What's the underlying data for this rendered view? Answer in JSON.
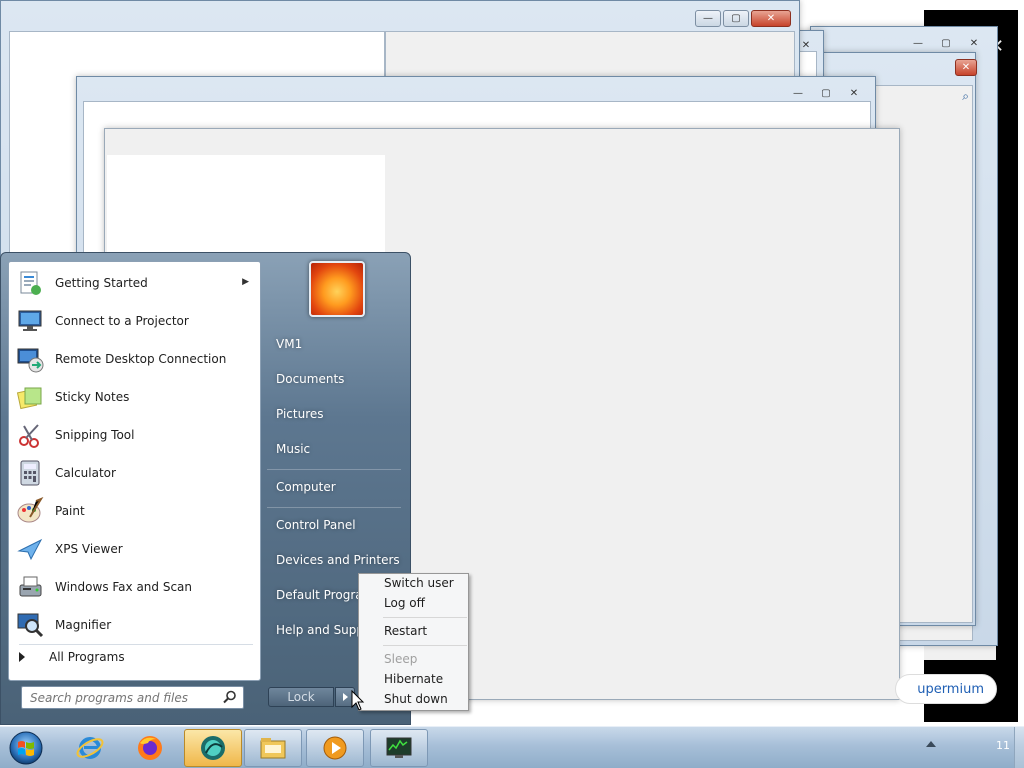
{
  "start_menu": {
    "programs": [
      {
        "label": "Getting Started",
        "icon": "getting-started-icon",
        "has_submenu": true
      },
      {
        "label": "Connect to a Projector",
        "icon": "projector-icon"
      },
      {
        "label": "Remote Desktop Connection",
        "icon": "remote-desktop-icon"
      },
      {
        "label": "Sticky Notes",
        "icon": "sticky-notes-icon"
      },
      {
        "label": "Snipping Tool",
        "icon": "snipping-tool-icon"
      },
      {
        "label": "Calculator",
        "icon": "calculator-icon"
      },
      {
        "label": "Paint",
        "icon": "paint-icon"
      },
      {
        "label": "XPS Viewer",
        "icon": "xps-viewer-icon"
      },
      {
        "label": "Windows Fax and Scan",
        "icon": "fax-scan-icon"
      },
      {
        "label": "Magnifier",
        "icon": "magnifier-icon"
      }
    ],
    "all_programs": "All Programs",
    "search_placeholder": "Search programs and files",
    "right_items": [
      {
        "label": "VM1"
      },
      {
        "label": "Documents"
      },
      {
        "label": "Pictures"
      },
      {
        "label": "Music"
      },
      {
        "label": "Computer"
      },
      {
        "label": "Control Panel"
      },
      {
        "label": "Devices and Printers"
      },
      {
        "label": "Default Programs"
      },
      {
        "label": "Help and Support"
      }
    ],
    "lock_label": "Lock"
  },
  "power_menu": {
    "items": [
      {
        "label": "Switch user",
        "enabled": true
      },
      {
        "label": "Log off",
        "enabled": true
      },
      {
        "label": "Restart",
        "enabled": true
      },
      {
        "label": "Sleep",
        "enabled": false
      },
      {
        "label": "Hibernate",
        "enabled": true
      },
      {
        "label": "Shut down",
        "enabled": true
      }
    ]
  },
  "background": {
    "browser_button_fragment": "upermium"
  },
  "taskbar": {
    "items": [
      "internet-explorer-icon",
      "firefox-icon",
      "supermium-icon",
      "file-explorer-icon",
      "media-player-icon",
      "task-manager-icon"
    ],
    "clock_fragment": "11"
  },
  "colors": {
    "start_menu_glass": "#5d7790",
    "taskbar": "#a7bfd8",
    "active_taskbar_item": "#f0b74a",
    "close_button": "#c7432b"
  }
}
